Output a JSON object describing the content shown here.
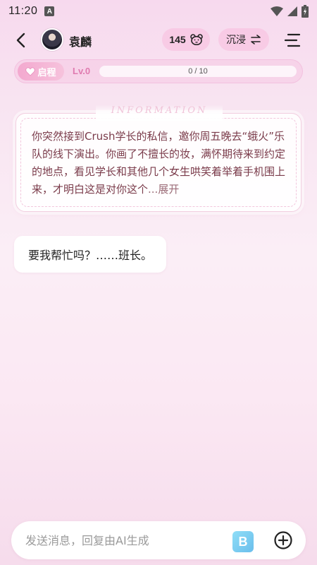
{
  "status": {
    "time": "11:20",
    "notif_icon": "A"
  },
  "header": {
    "character_name": "袁麟",
    "coins": "145",
    "mode_label": "沉浸"
  },
  "level": {
    "badge_label": "启程",
    "level_text": "Lv.0",
    "progress_text": "0 / 10",
    "progress_fraction": 0
  },
  "info": {
    "title": "INFORMATION",
    "text": "你突然接到Crush学长的私信，邀你周五晚去“蛾火”乐队的线下演出。你画了不擅长的妆，满怀期待来到约定的地点，看见学长和其他几个女生哄笑着举着手机围上来，才明白这是对你这个",
    "expand_label": "...展开"
  },
  "messages": [
    {
      "role": "character",
      "text": "要我帮忙吗？……班长。"
    }
  ],
  "input": {
    "placeholder": "发送消息，回复由AI生成"
  },
  "colors": {
    "accent_pink": "#f3a9cf",
    "level_pink": "#e07bb0",
    "story_text": "#7a3b4a"
  }
}
